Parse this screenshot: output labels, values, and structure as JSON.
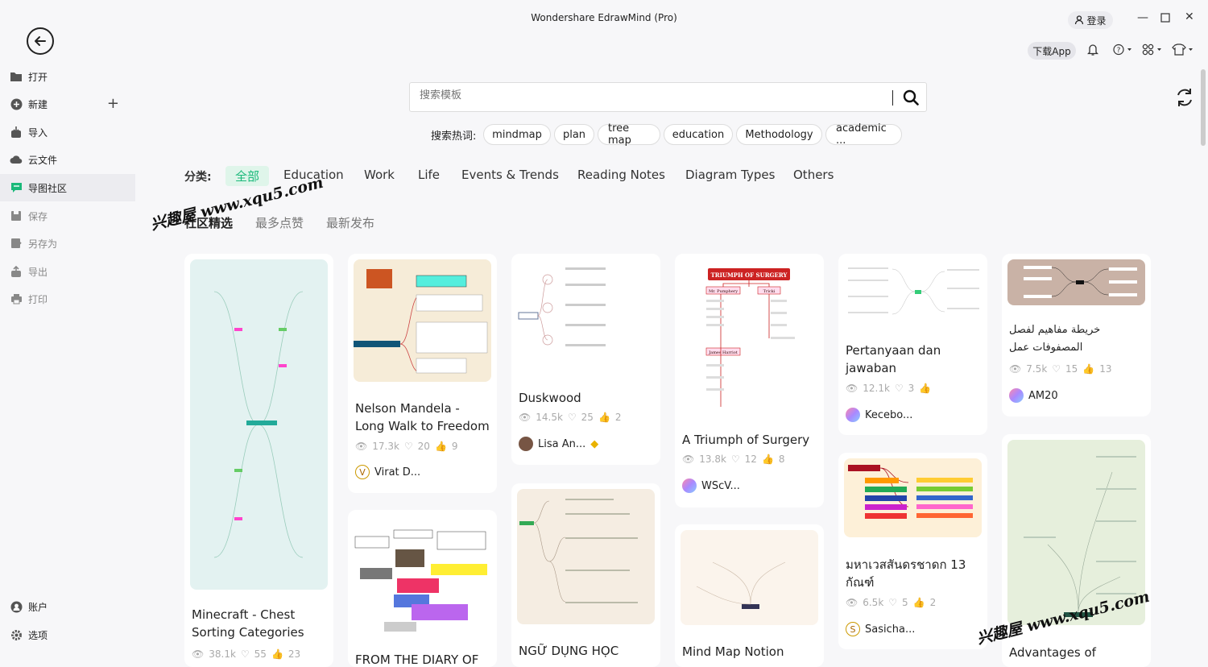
{
  "window": {
    "title": "Wondershare EdrawMind (Pro)",
    "login": "登录",
    "download_app": "下载App"
  },
  "sidebar": {
    "items": [
      {
        "label": "打开"
      },
      {
        "label": "新建"
      },
      {
        "label": "导入"
      },
      {
        "label": "云文件"
      },
      {
        "label": "导图社区"
      },
      {
        "label": "保存"
      },
      {
        "label": "另存为"
      },
      {
        "label": "导出"
      },
      {
        "label": "打印"
      }
    ],
    "bottom": [
      {
        "label": "账户"
      },
      {
        "label": "选项"
      }
    ]
  },
  "search": {
    "placeholder": "搜索模板"
  },
  "hot": {
    "label": "搜索热词:",
    "tags": [
      "mindmap",
      "plan",
      "tree map",
      "education",
      "Methodology",
      "academic ..."
    ]
  },
  "categories": {
    "label": "分类:",
    "items": [
      "全部",
      "Education",
      "Work",
      "Life",
      "Events & Trends",
      "Reading Notes",
      "Diagram Types",
      "Others"
    ]
  },
  "subtabs": [
    "社区精选",
    "最多点赞",
    "最新发布"
  ],
  "watermarks": [
    "兴趣屋 www.xqu5.com",
    "兴趣屋 www.xqu5.com"
  ],
  "cards": [
    {
      "title": "Minecraft - Chest Sorting Categories",
      "views": "38.1k",
      "likes": "55",
      "thumbs": "23"
    },
    {
      "title": "Nelson Mandela - Long Walk to Freedom",
      "views": "17.3k",
      "likes": "20",
      "thumbs": "9",
      "author": "Virat D...",
      "initial": "V"
    },
    {
      "title": "FROM THE DIARY OF"
    },
    {
      "title": "Duskwood",
      "views": "14.5k",
      "likes": "25",
      "thumbs": "2",
      "author": "Lisa An..."
    },
    {
      "title": "NGỮ DỤNG HỌC"
    },
    {
      "title": "A Triumph of Surgery",
      "views": "13.8k",
      "likes": "12",
      "thumbs": "8",
      "author": "WScV..."
    },
    {
      "title": "Mind Map Notion"
    },
    {
      "title": "Pertanyaan dan jawaban",
      "views": "12.1k",
      "likes": "3",
      "thumbs": "",
      "author": "Kecebo..."
    },
    {
      "title": "มหาเวสสันดรชาดก 13 กัณฑ์",
      "views": "6.5k",
      "likes": "5",
      "thumbs": "2",
      "author": "Sasicha...",
      "initial": "S"
    },
    {
      "title": "خريطة مفاهيم لفصل المصفوفات عمل",
      "views": "7.5k",
      "likes": "15",
      "thumbs": "13",
      "author": "AM20"
    },
    {
      "title": "Advantages of"
    }
  ],
  "thumb_texts": {
    "surgery": "TRIUMPH OF SURGERY",
    "surgery_a": "Mr. Pumphery",
    "surgery_b": "Tricki",
    "surgery_c": "James Harriot"
  },
  "colors": {
    "accent": "#1ab97a",
    "accent_bg": "#dff5ea"
  }
}
